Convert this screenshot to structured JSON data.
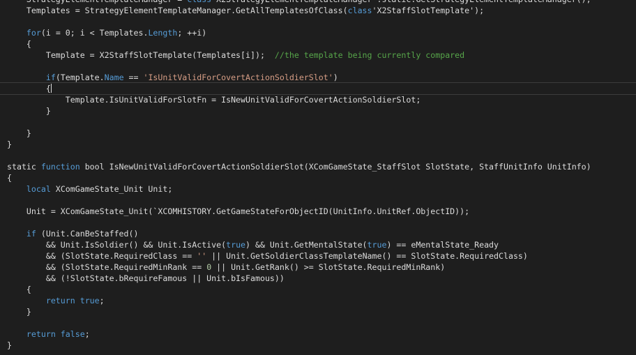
{
  "editor": {
    "colors": {
      "background": "#1e1e1e",
      "text": "#dcdcdc",
      "keyword": "#569cd6",
      "string": "#d69d85",
      "comment": "#57a64a",
      "number": "#b5cea8",
      "current_line_border": "#3c3c3c"
    },
    "current_line_index": 8,
    "caret_after_token": {
      "line": 8,
      "token": 1
    },
    "lines": [
      [
        [
          "tx",
          "    StrategyElementTemplateManager = "
        ],
        [
          "kw",
          "class"
        ],
        [
          "tx",
          "'X2StrategyElementTemplateManager'.static.GetStrategyElementTemplateManager();"
        ]
      ],
      [
        [
          "tx",
          "    Templates = StrategyElementTemplateManager.GetAllTemplatesOfClass("
        ],
        [
          "kw",
          "class"
        ],
        [
          "tx",
          "'X2StaffSlotTemplate');"
        ]
      ],
      [
        [
          "tx",
          ""
        ]
      ],
      [
        [
          "tx",
          "    "
        ],
        [
          "kw",
          "for"
        ],
        [
          "tx",
          "(i = 0; i < Templates."
        ],
        [
          "kw",
          "Length"
        ],
        [
          "tx",
          "; ++i)"
        ]
      ],
      [
        [
          "tx",
          "    {"
        ]
      ],
      [
        [
          "tx",
          "        Template = X2StaffSlotTemplate(Templates[i]);  "
        ],
        [
          "cm",
          "//the template being currently compared"
        ]
      ],
      [
        [
          "tx",
          ""
        ]
      ],
      [
        [
          "tx",
          "        "
        ],
        [
          "kw",
          "if"
        ],
        [
          "tx",
          "(Template."
        ],
        [
          "kw",
          "Name"
        ],
        [
          "tx",
          " == "
        ],
        [
          "str",
          "'IsUnitValidForCovertActionSoldierSlot'"
        ],
        [
          "tx",
          ")"
        ]
      ],
      [
        [
          "tx",
          "        "
        ],
        [
          "tx",
          "{"
        ]
      ],
      [
        [
          "tx",
          "            Template.IsUnitValidForSlotFn = IsNewUnitValidForCovertActionSoldierSlot;"
        ]
      ],
      [
        [
          "tx",
          "        }"
        ]
      ],
      [
        [
          "tx",
          ""
        ]
      ],
      [
        [
          "tx",
          "    }"
        ]
      ],
      [
        [
          "tx",
          "}"
        ]
      ],
      [
        [
          "tx",
          ""
        ]
      ],
      [
        [
          "tx",
          "static "
        ],
        [
          "kw",
          "function"
        ],
        [
          "tx",
          " bool IsNewUnitValidForCovertActionSoldierSlot(XComGameState_StaffSlot SlotState, StaffUnitInfo UnitInfo)"
        ]
      ],
      [
        [
          "tx",
          "{"
        ]
      ],
      [
        [
          "tx",
          "    "
        ],
        [
          "kw",
          "local"
        ],
        [
          "tx",
          " XComGameState_Unit Unit;"
        ]
      ],
      [
        [
          "tx",
          ""
        ]
      ],
      [
        [
          "tx",
          "    Unit = XComGameState_Unit(`XCOMHISTORY.GetGameStateForObjectID(UnitInfo.UnitRef.ObjectID));"
        ]
      ],
      [
        [
          "tx",
          ""
        ]
      ],
      [
        [
          "tx",
          "    "
        ],
        [
          "kw",
          "if"
        ],
        [
          "tx",
          " (Unit.CanBeStaffed()"
        ]
      ],
      [
        [
          "tx",
          "        && Unit.IsSoldier() && Unit.IsActive("
        ],
        [
          "kw",
          "true"
        ],
        [
          "tx",
          ") && Unit.GetMentalState("
        ],
        [
          "kw",
          "true"
        ],
        [
          "tx",
          ") == eMentalState_Ready"
        ]
      ],
      [
        [
          "tx",
          "        && (SlotState.RequiredClass == "
        ],
        [
          "str",
          "''"
        ],
        [
          "tx",
          " || Unit.GetSoldierClassTemplateName() == SlotState.RequiredClass)"
        ]
      ],
      [
        [
          "tx",
          "        && (SlotState.RequiredMinRank == "
        ],
        [
          "num",
          "0"
        ],
        [
          "tx",
          " || Unit.GetRank() >= SlotState.RequiredMinRank)"
        ]
      ],
      [
        [
          "tx",
          "        && (!SlotState.bRequireFamous || Unit.bIsFamous))"
        ]
      ],
      [
        [
          "tx",
          "    {"
        ]
      ],
      [
        [
          "tx",
          "        "
        ],
        [
          "kw",
          "return"
        ],
        [
          "tx",
          " "
        ],
        [
          "kw",
          "true"
        ],
        [
          "tx",
          ";"
        ]
      ],
      [
        [
          "tx",
          "    }"
        ]
      ],
      [
        [
          "tx",
          ""
        ]
      ],
      [
        [
          "tx",
          "    "
        ],
        [
          "kw",
          "return"
        ],
        [
          "tx",
          " "
        ],
        [
          "kw",
          "false"
        ],
        [
          "tx",
          ";"
        ]
      ],
      [
        [
          "tx",
          "}"
        ]
      ]
    ]
  }
}
